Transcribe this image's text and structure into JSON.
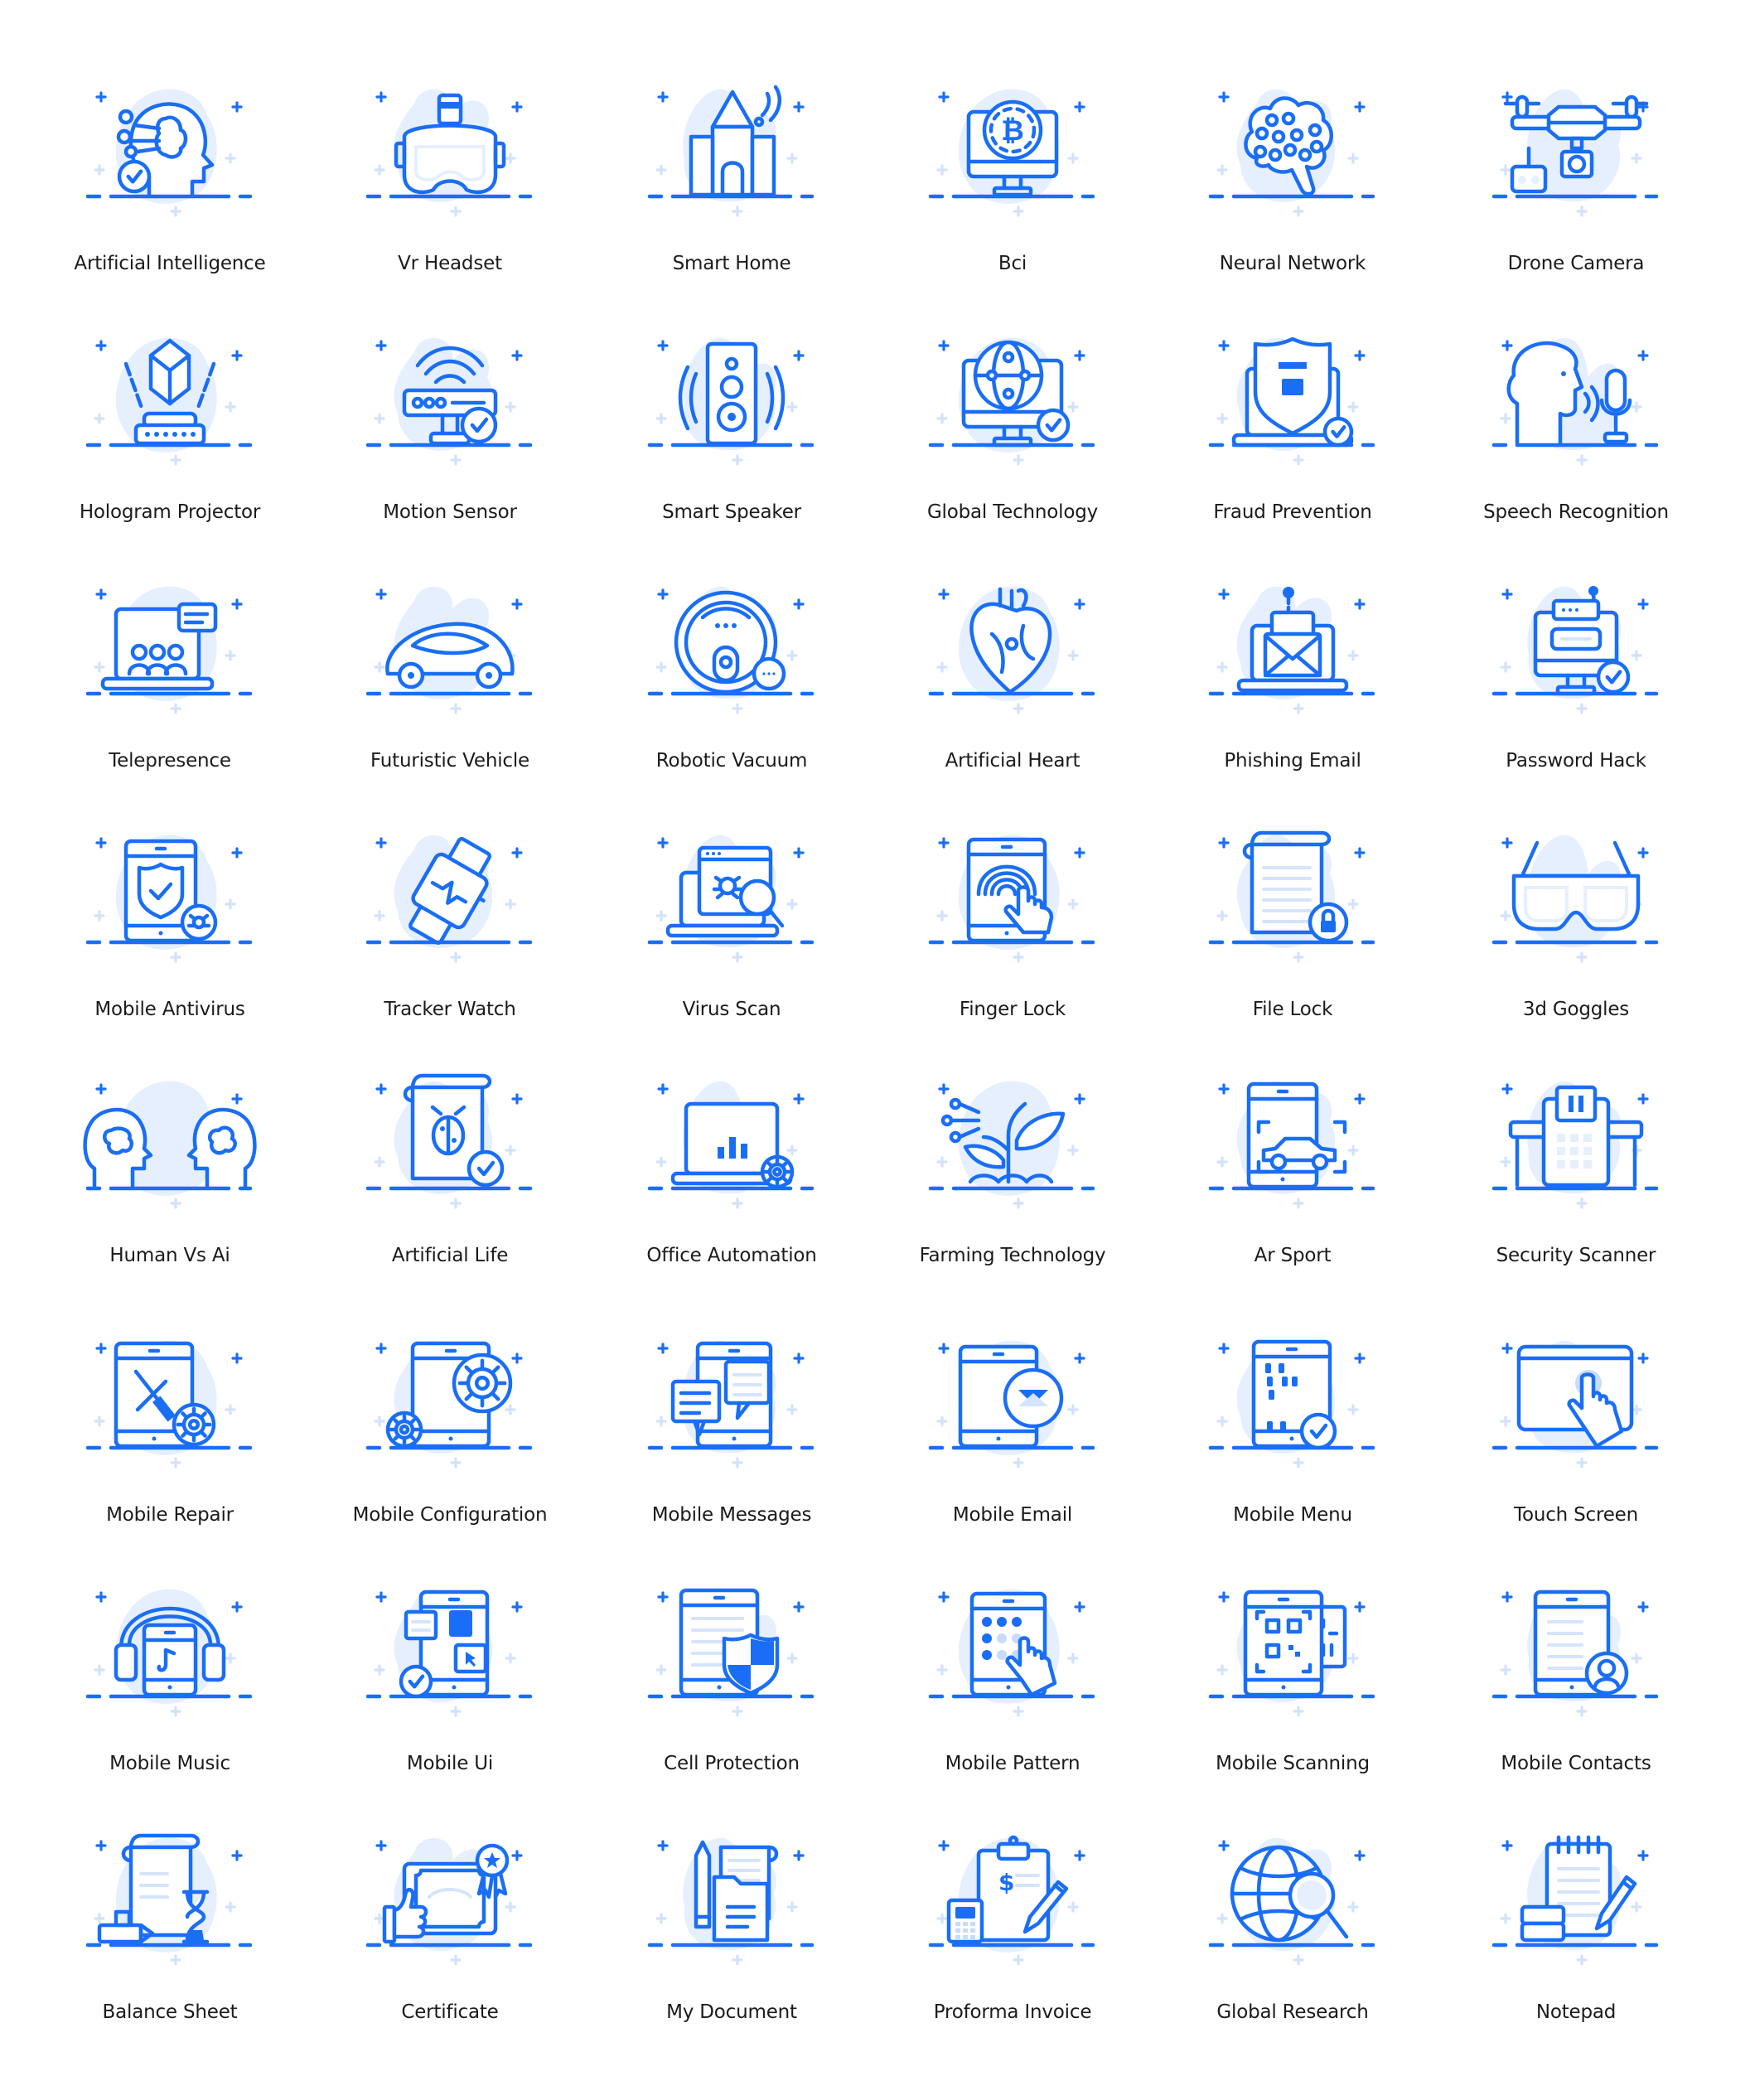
{
  "page": {
    "background": "#ffffff"
  },
  "theme": {
    "accent": "#1a6ef5",
    "blob": "#e6effd",
    "label_color": "#1b1b1b"
  },
  "rows": [
    {
      "items": [
        {
          "label": "Artificial Intelligence",
          "icon": "ai-head-icon"
        },
        {
          "label": "Vr Headset",
          "icon": "vr-headset-icon"
        },
        {
          "label": "Smart Home",
          "icon": "smart-home-icon"
        },
        {
          "label": "Bci",
          "icon": "bitcoin-monitor-icon"
        },
        {
          "label": "Neural Network",
          "icon": "neural-network-icon"
        },
        {
          "label": "Drone Camera",
          "icon": "drone-camera-icon"
        }
      ]
    },
    {
      "items": [
        {
          "label": "Hologram Projector",
          "icon": "hologram-projector-icon"
        },
        {
          "label": "Motion Sensor",
          "icon": "motion-sensor-icon"
        },
        {
          "label": "Smart Speaker",
          "icon": "smart-speaker-icon"
        },
        {
          "label": "Global Technology",
          "icon": "global-technology-icon"
        },
        {
          "label": "Fraud Prevention",
          "icon": "fraud-prevention-icon"
        },
        {
          "label": "Speech Recognition",
          "icon": "speech-recognition-icon"
        }
      ]
    },
    {
      "items": [
        {
          "label": "Telepresence",
          "icon": "telepresence-icon"
        },
        {
          "label": "Futuristic Vehicle",
          "icon": "futuristic-vehicle-icon"
        },
        {
          "label": "Robotic Vacuum",
          "icon": "robotic-vacuum-icon"
        },
        {
          "label": "Artificial Heart",
          "icon": "artificial-heart-icon"
        },
        {
          "label": "Phishing Email",
          "icon": "phishing-email-icon"
        },
        {
          "label": "Password Hack",
          "icon": "password-hack-icon"
        }
      ]
    },
    {
      "items": [
        {
          "label": "Mobile Antivirus",
          "icon": "mobile-antivirus-icon"
        },
        {
          "label": "Tracker Watch",
          "icon": "tracker-watch-icon"
        },
        {
          "label": "Virus Scan",
          "icon": "virus-scan-icon"
        },
        {
          "label": "Finger Lock",
          "icon": "finger-lock-icon"
        },
        {
          "label": "File Lock",
          "icon": "file-lock-icon"
        },
        {
          "label": "3d Goggles",
          "icon": "3d-goggles-icon"
        }
      ]
    },
    {
      "items": [
        {
          "label": "Human Vs Ai",
          "icon": "human-vs-ai-icon"
        },
        {
          "label": "Artificial Life",
          "icon": "artificial-life-icon"
        },
        {
          "label": "Office Automation",
          "icon": "office-automation-icon"
        },
        {
          "label": "Farming Technology",
          "icon": "farming-technology-icon"
        },
        {
          "label": "Ar Sport",
          "icon": "ar-sport-icon"
        },
        {
          "label": "Security Scanner",
          "icon": "security-scanner-icon"
        }
      ]
    },
    {
      "items": [
        {
          "label": "Mobile Repair",
          "icon": "mobile-repair-icon"
        },
        {
          "label": "Mobile Configuration",
          "icon": "mobile-configuration-icon"
        },
        {
          "label": "Mobile Messages",
          "icon": "mobile-messages-icon"
        },
        {
          "label": "Mobile Email",
          "icon": "mobile-email-icon"
        },
        {
          "label": "Mobile Menu",
          "icon": "mobile-menu-icon"
        },
        {
          "label": "Touch Screen",
          "icon": "touch-screen-icon"
        }
      ]
    },
    {
      "items": [
        {
          "label": "Mobile Music",
          "icon": "mobile-music-icon"
        },
        {
          "label": "Mobile Ui",
          "icon": "mobile-ui-icon"
        },
        {
          "label": "Cell Protection",
          "icon": "cell-protection-icon"
        },
        {
          "label": "Mobile Pattern",
          "icon": "mobile-pattern-icon"
        },
        {
          "label": "Mobile Scanning",
          "icon": "mobile-scanning-icon"
        },
        {
          "label": "Mobile Contacts",
          "icon": "mobile-contacts-icon"
        }
      ]
    },
    {
      "items": [
        {
          "label": "Balance Sheet",
          "icon": "balance-sheet-icon"
        },
        {
          "label": "Certificate",
          "icon": "certificate-icon"
        },
        {
          "label": "My Document",
          "icon": "my-document-icon"
        },
        {
          "label": "Proforma Invoice",
          "icon": "proforma-invoice-icon"
        },
        {
          "label": "Global Research",
          "icon": "global-research-icon"
        },
        {
          "label": "Notepad",
          "icon": "notepad-icon"
        }
      ]
    }
  ]
}
